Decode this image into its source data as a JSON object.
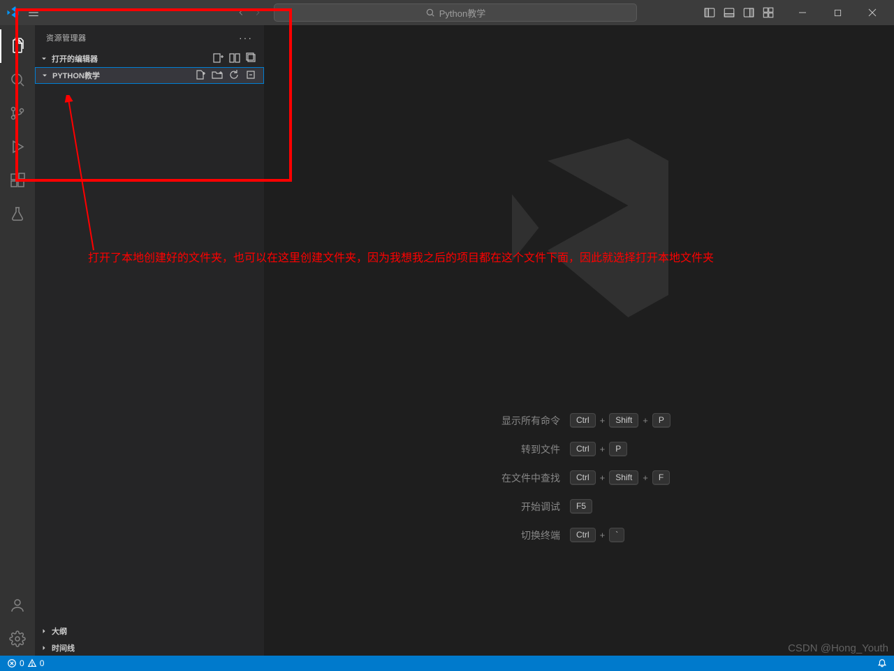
{
  "titlebar": {
    "search_placeholder": "Python教学"
  },
  "sidebar": {
    "title": "资源管理器",
    "more_label": "···",
    "sections": {
      "open_editors": "打开的编辑器",
      "folder": "PYTHON教学"
    },
    "bottom": {
      "outline": "大纲",
      "timeline": "时间线"
    }
  },
  "shortcuts": [
    {
      "label": "显示所有命令",
      "keys": [
        "Ctrl",
        "Shift",
        "P"
      ]
    },
    {
      "label": "转到文件",
      "keys": [
        "Ctrl",
        "P"
      ]
    },
    {
      "label": "在文件中查找",
      "keys": [
        "Ctrl",
        "Shift",
        "F"
      ]
    },
    {
      "label": "开始调试",
      "keys": [
        "F5"
      ]
    },
    {
      "label": "切换终端",
      "keys": [
        "Ctrl",
        "`"
      ]
    }
  ],
  "statusbar": {
    "errors": "0",
    "warnings": "0"
  },
  "annotation": {
    "text": "打开了本地创建好的文件夹，也可以在这里创建文件夹，因为我想我之后的项目都在这个文件下面，因此就选择打开本地文件夹"
  },
  "watermark": "CSDN @Hong_Youth"
}
